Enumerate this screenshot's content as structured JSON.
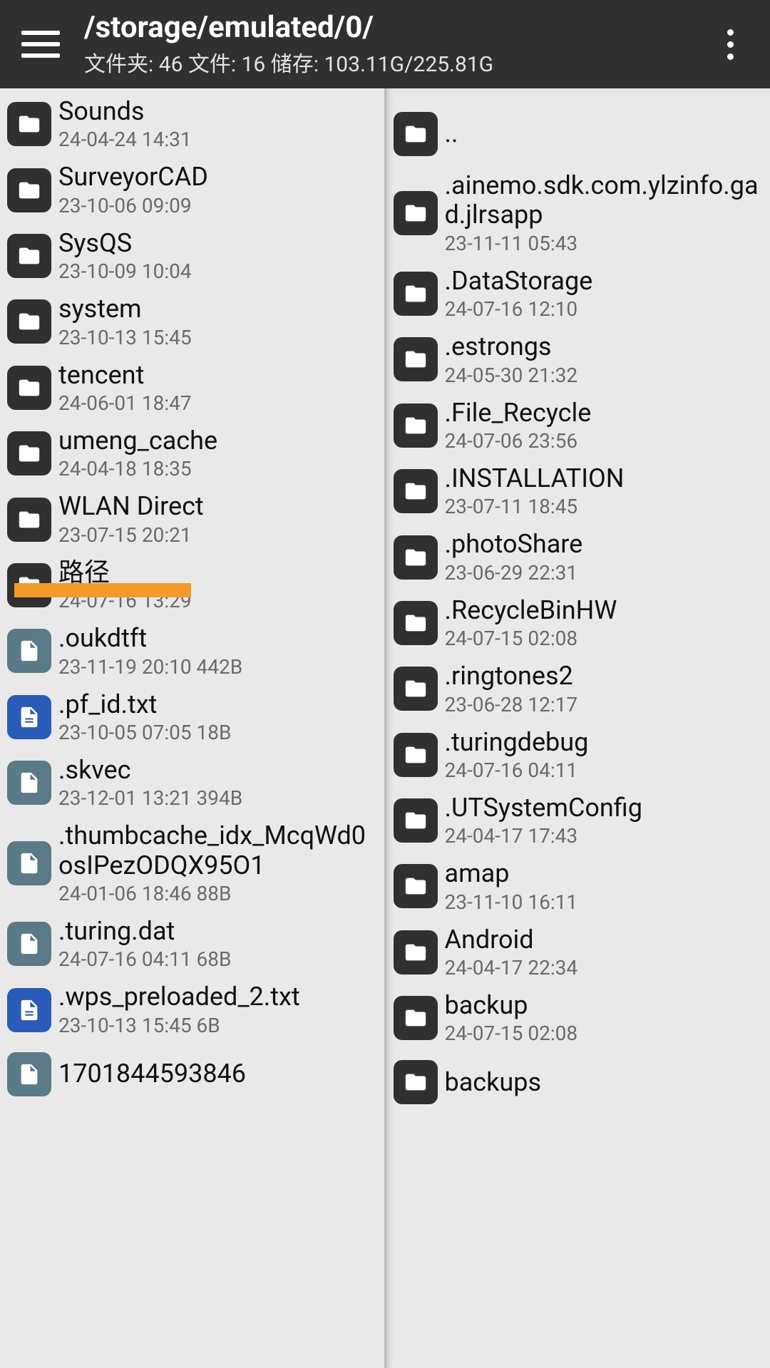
{
  "header": {
    "path": "/storage/emulated/0/",
    "stats": "文件夹: 46  文件: 16  储存: 103.11G/225.81G"
  },
  "left": [
    {
      "type": "folder",
      "name": "Sounds",
      "meta": "24-04-24 14:31"
    },
    {
      "type": "folder",
      "name": "SurveyorCAD",
      "meta": "23-10-06 09:09"
    },
    {
      "type": "folder",
      "name": "SysQS",
      "meta": "23-10-09 10:04"
    },
    {
      "type": "folder",
      "name": "system",
      "meta": "23-10-13 15:45"
    },
    {
      "type": "folder",
      "name": "tencent",
      "meta": "24-06-01 18:47"
    },
    {
      "type": "folder",
      "name": "umeng_cache",
      "meta": "24-04-18 18:35"
    },
    {
      "type": "folder",
      "name": "WLAN Direct",
      "meta": "23-07-15 20:21"
    },
    {
      "type": "folder",
      "name": "路径",
      "meta": "24-07-16 13:29"
    },
    {
      "type": "file",
      "name": ".oukdtft",
      "meta": "23-11-19 20:10  442B"
    },
    {
      "type": "txt",
      "name": ".pf_id.txt",
      "meta": "23-10-05 07:05  18B"
    },
    {
      "type": "file",
      "name": ".skvec",
      "meta": "23-12-01 13:21  394B"
    },
    {
      "type": "file",
      "name": ".thumbcache_idx_McqWd0osIPezODQX95O1",
      "meta": "24-01-06 18:46  88B"
    },
    {
      "type": "file",
      "name": ".turing.dat",
      "meta": "24-07-16 04:11  68B"
    },
    {
      "type": "txt",
      "name": ".wps_preloaded_2.txt",
      "meta": "23-10-13 15:45  6B"
    },
    {
      "type": "file",
      "name": "1701844593846",
      "meta": ""
    }
  ],
  "right": [
    {
      "type": "up",
      "name": "..",
      "meta": ""
    },
    {
      "type": "folder",
      "name": ".ainemo.sdk.com.ylzinfo.gad.jlrsapp",
      "meta": "23-11-11 05:43"
    },
    {
      "type": "folder",
      "name": ".DataStorage",
      "meta": "24-07-16 12:10"
    },
    {
      "type": "folder",
      "name": ".estrongs",
      "meta": "24-05-30 21:32"
    },
    {
      "type": "folder",
      "name": ".File_Recycle",
      "meta": "24-07-06 23:56"
    },
    {
      "type": "folder",
      "name": ".INSTALLATION",
      "meta": "23-07-11 18:45"
    },
    {
      "type": "folder",
      "name": ".photoShare",
      "meta": "23-06-29 22:31"
    },
    {
      "type": "folder",
      "name": ".RecycleBinHW",
      "meta": "24-07-15 02:08"
    },
    {
      "type": "folder",
      "name": ".ringtones2",
      "meta": "23-06-28 12:17"
    },
    {
      "type": "folder",
      "name": ".turingdebug",
      "meta": "24-07-16 04:11"
    },
    {
      "type": "folder",
      "name": ".UTSystemConfig",
      "meta": "24-04-17 17:43"
    },
    {
      "type": "folder",
      "name": "amap",
      "meta": "23-11-10 16:11"
    },
    {
      "type": "folder",
      "name": "Android",
      "meta": "24-04-17 22:34"
    },
    {
      "type": "folder",
      "name": "backup",
      "meta": "24-07-15 02:08"
    },
    {
      "type": "folder",
      "name": "backups",
      "meta": ""
    }
  ]
}
